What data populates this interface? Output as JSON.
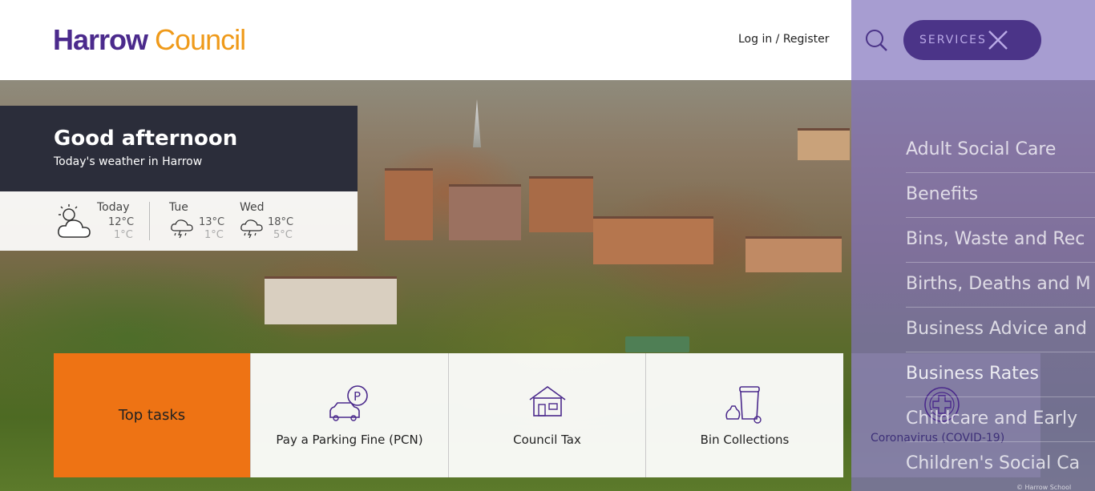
{
  "header": {
    "logo_part1": "Harrow",
    "logo_part2": "Council",
    "login_label": "Log in / Register",
    "services_label": "SERVICES"
  },
  "greeting": {
    "title": "Good afternoon",
    "subtitle": "Today's weather in Harrow"
  },
  "weather": [
    {
      "day": "Today",
      "high": "12°C",
      "low": "1°C",
      "icon": "partly-cloudy-icon"
    },
    {
      "day": "Tue",
      "high": "13°C",
      "low": "1°C",
      "icon": "thunder-cloud-icon"
    },
    {
      "day": "Wed",
      "high": "18°C",
      "low": "5°C",
      "icon": "thunder-cloud-icon"
    }
  ],
  "top_tasks": {
    "heading": "Top tasks",
    "items": [
      {
        "label": "Pay a Parking Fine (PCN)",
        "icon": "parking-car-icon"
      },
      {
        "label": "Council Tax",
        "icon": "house-icon"
      },
      {
        "label": "Bin Collections",
        "icon": "bin-icon"
      },
      {
        "label": "Coronavirus (COVID-19)",
        "icon": "medical-cross-icon"
      }
    ]
  },
  "services_menu": [
    "Adult Social Care",
    "Benefits",
    "Bins, Waste and Rec",
    "Births, Deaths and M",
    "Business Advice and",
    "Business Rates",
    "Childcare and Early",
    "Children's Social Ca"
  ],
  "photo_credit": "© Harrow School",
  "colors": {
    "brand_purple": "#4b2a8c",
    "brand_orange": "#ef9a1a",
    "tile_orange": "#ee7314",
    "greeting_bg": "#2b2d3a",
    "overlay_purple": "#8273be"
  }
}
